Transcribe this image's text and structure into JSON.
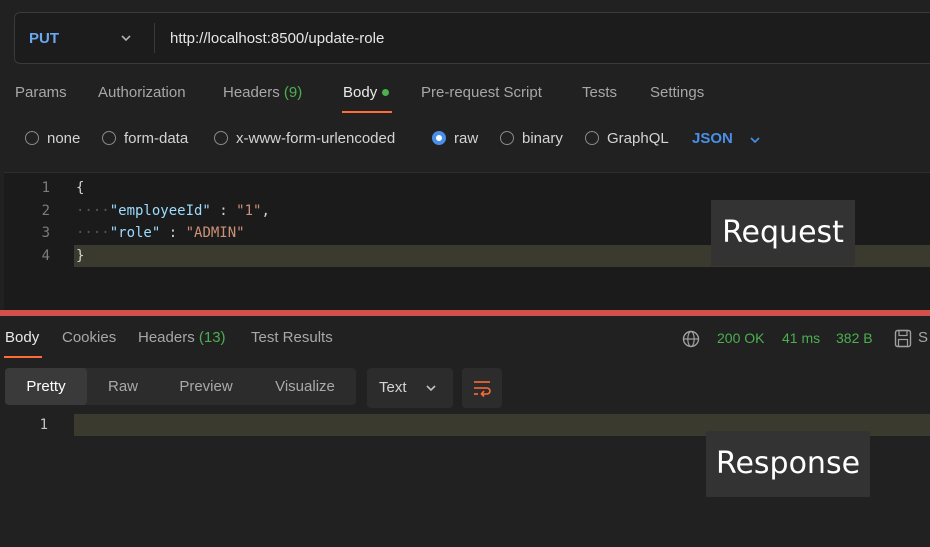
{
  "request": {
    "method": "PUT",
    "url": "http://localhost:8500/update-role"
  },
  "request_tabs": [
    {
      "label": "Params"
    },
    {
      "label": "Authorization"
    },
    {
      "label": "Headers",
      "count": "(9)"
    },
    {
      "label": "Body",
      "active": true
    },
    {
      "label": "Pre-request Script"
    },
    {
      "label": "Tests"
    },
    {
      "label": "Settings"
    }
  ],
  "body_types": {
    "none": "none",
    "form_data": "form-data",
    "urlencoded": "x-www-form-urlencoded",
    "raw": "raw",
    "binary": "binary",
    "graphql": "GraphQL",
    "selected": "raw",
    "language": "JSON"
  },
  "editor": {
    "line_numbers": [
      "1",
      "2",
      "3",
      "4"
    ],
    "open_brace": "{",
    "close_brace": "}",
    "fields": [
      {
        "key": "\"employeeId\"",
        "value": "\"1\"",
        "trail": ","
      },
      {
        "key": "\"role\"",
        "value": "\"ADMIN\"",
        "trail": ""
      }
    ]
  },
  "response_tabs": [
    {
      "label": "Body",
      "active": true
    },
    {
      "label": "Cookies"
    },
    {
      "label": "Headers",
      "count": "(13)"
    },
    {
      "label": "Test Results"
    }
  ],
  "response_status": {
    "code": "200 OK",
    "time": "41 ms",
    "size": "382 B",
    "save_partial": "S"
  },
  "view_modes": [
    "Pretty",
    "Raw",
    "Preview",
    "Visualize"
  ],
  "active_view": "Pretty",
  "format": "Text",
  "response_line_numbers": [
    "1"
  ],
  "overlays": {
    "request": "Request",
    "response": "Response"
  },
  "colors": {
    "accent_orange": "#ff6c37",
    "method_blue": "#6aa7ef",
    "success_green": "#4caf50",
    "divider_red": "#d1504a"
  }
}
